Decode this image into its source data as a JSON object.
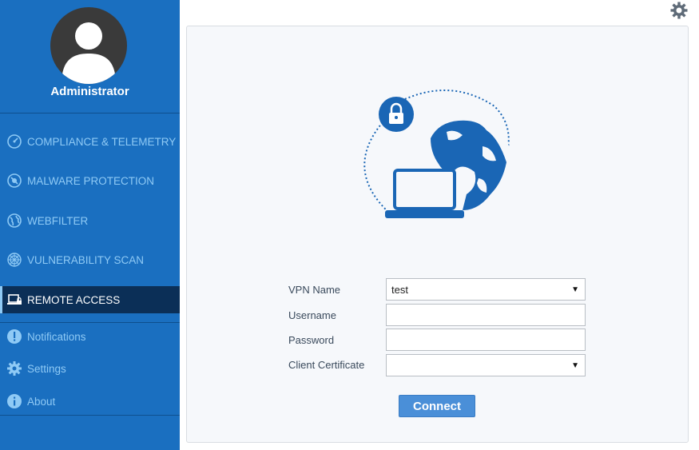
{
  "user": {
    "name": "Administrator"
  },
  "sidebar": {
    "items": [
      {
        "label": "COMPLIANCE & TELEMETRY",
        "icon": "speedometer-icon"
      },
      {
        "label": "MALWARE PROTECTION",
        "icon": "malware-shield-icon"
      },
      {
        "label": "WEBFILTER",
        "icon": "globe-filter-icon"
      },
      {
        "label": "VULNERABILITY SCAN",
        "icon": "radar-icon"
      },
      {
        "label": "REMOTE ACCESS",
        "icon": "laptop-lock-icon",
        "active": true
      },
      {
        "label": "Notifications",
        "icon": "exclamation-icon"
      },
      {
        "label": "Settings",
        "icon": "gear-icon"
      },
      {
        "label": "About",
        "icon": "info-icon"
      }
    ]
  },
  "form": {
    "vpn_name_label": "VPN Name",
    "vpn_name_value": "test",
    "username_label": "Username",
    "username_value": "",
    "password_label": "Password",
    "password_value": "",
    "client_cert_label": "Client Certificate",
    "client_cert_value": "",
    "connect_label": "Connect"
  },
  "colors": {
    "sidebar_bg": "#1a6fc0",
    "sidebar_active_bg": "#0b2f57",
    "sidebar_text": "#8fcaf5",
    "illustration_blue": "#1a66b5",
    "button_bg": "#4a8fd8"
  }
}
